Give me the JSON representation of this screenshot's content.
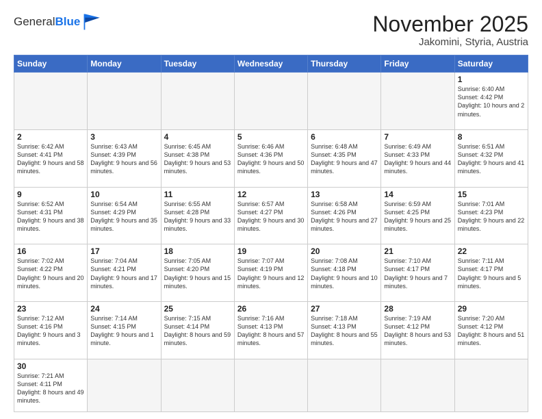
{
  "header": {
    "logo_general": "General",
    "logo_blue": "Blue",
    "month": "November 2025",
    "location": "Jakomini, Styria, Austria"
  },
  "weekdays": [
    "Sunday",
    "Monday",
    "Tuesday",
    "Wednesday",
    "Thursday",
    "Friday",
    "Saturday"
  ],
  "weeks": [
    [
      {
        "day": "",
        "info": ""
      },
      {
        "day": "",
        "info": ""
      },
      {
        "day": "",
        "info": ""
      },
      {
        "day": "",
        "info": ""
      },
      {
        "day": "",
        "info": ""
      },
      {
        "day": "",
        "info": ""
      },
      {
        "day": "1",
        "info": "Sunrise: 6:40 AM\nSunset: 4:42 PM\nDaylight: 10 hours\nand 2 minutes."
      }
    ],
    [
      {
        "day": "2",
        "info": "Sunrise: 6:42 AM\nSunset: 4:41 PM\nDaylight: 9 hours\nand 58 minutes."
      },
      {
        "day": "3",
        "info": "Sunrise: 6:43 AM\nSunset: 4:39 PM\nDaylight: 9 hours\nand 56 minutes."
      },
      {
        "day": "4",
        "info": "Sunrise: 6:45 AM\nSunset: 4:38 PM\nDaylight: 9 hours\nand 53 minutes."
      },
      {
        "day": "5",
        "info": "Sunrise: 6:46 AM\nSunset: 4:36 PM\nDaylight: 9 hours\nand 50 minutes."
      },
      {
        "day": "6",
        "info": "Sunrise: 6:48 AM\nSunset: 4:35 PM\nDaylight: 9 hours\nand 47 minutes."
      },
      {
        "day": "7",
        "info": "Sunrise: 6:49 AM\nSunset: 4:33 PM\nDaylight: 9 hours\nand 44 minutes."
      },
      {
        "day": "8",
        "info": "Sunrise: 6:51 AM\nSunset: 4:32 PM\nDaylight: 9 hours\nand 41 minutes."
      }
    ],
    [
      {
        "day": "9",
        "info": "Sunrise: 6:52 AM\nSunset: 4:31 PM\nDaylight: 9 hours\nand 38 minutes."
      },
      {
        "day": "10",
        "info": "Sunrise: 6:54 AM\nSunset: 4:29 PM\nDaylight: 9 hours\nand 35 minutes."
      },
      {
        "day": "11",
        "info": "Sunrise: 6:55 AM\nSunset: 4:28 PM\nDaylight: 9 hours\nand 33 minutes."
      },
      {
        "day": "12",
        "info": "Sunrise: 6:57 AM\nSunset: 4:27 PM\nDaylight: 9 hours\nand 30 minutes."
      },
      {
        "day": "13",
        "info": "Sunrise: 6:58 AM\nSunset: 4:26 PM\nDaylight: 9 hours\nand 27 minutes."
      },
      {
        "day": "14",
        "info": "Sunrise: 6:59 AM\nSunset: 4:25 PM\nDaylight: 9 hours\nand 25 minutes."
      },
      {
        "day": "15",
        "info": "Sunrise: 7:01 AM\nSunset: 4:23 PM\nDaylight: 9 hours\nand 22 minutes."
      }
    ],
    [
      {
        "day": "16",
        "info": "Sunrise: 7:02 AM\nSunset: 4:22 PM\nDaylight: 9 hours\nand 20 minutes."
      },
      {
        "day": "17",
        "info": "Sunrise: 7:04 AM\nSunset: 4:21 PM\nDaylight: 9 hours\nand 17 minutes."
      },
      {
        "day": "18",
        "info": "Sunrise: 7:05 AM\nSunset: 4:20 PM\nDaylight: 9 hours\nand 15 minutes."
      },
      {
        "day": "19",
        "info": "Sunrise: 7:07 AM\nSunset: 4:19 PM\nDaylight: 9 hours\nand 12 minutes."
      },
      {
        "day": "20",
        "info": "Sunrise: 7:08 AM\nSunset: 4:18 PM\nDaylight: 9 hours\nand 10 minutes."
      },
      {
        "day": "21",
        "info": "Sunrise: 7:10 AM\nSunset: 4:17 PM\nDaylight: 9 hours\nand 7 minutes."
      },
      {
        "day": "22",
        "info": "Sunrise: 7:11 AM\nSunset: 4:17 PM\nDaylight: 9 hours\nand 5 minutes."
      }
    ],
    [
      {
        "day": "23",
        "info": "Sunrise: 7:12 AM\nSunset: 4:16 PM\nDaylight: 9 hours\nand 3 minutes."
      },
      {
        "day": "24",
        "info": "Sunrise: 7:14 AM\nSunset: 4:15 PM\nDaylight: 9 hours\nand 1 minute."
      },
      {
        "day": "25",
        "info": "Sunrise: 7:15 AM\nSunset: 4:14 PM\nDaylight: 8 hours\nand 59 minutes."
      },
      {
        "day": "26",
        "info": "Sunrise: 7:16 AM\nSunset: 4:13 PM\nDaylight: 8 hours\nand 57 minutes."
      },
      {
        "day": "27",
        "info": "Sunrise: 7:18 AM\nSunset: 4:13 PM\nDaylight: 8 hours\nand 55 minutes."
      },
      {
        "day": "28",
        "info": "Sunrise: 7:19 AM\nSunset: 4:12 PM\nDaylight: 8 hours\nand 53 minutes."
      },
      {
        "day": "29",
        "info": "Sunrise: 7:20 AM\nSunset: 4:12 PM\nDaylight: 8 hours\nand 51 minutes."
      }
    ],
    [
      {
        "day": "30",
        "info": "Sunrise: 7:21 AM\nSunset: 4:11 PM\nDaylight: 8 hours\nand 49 minutes."
      },
      {
        "day": "",
        "info": ""
      },
      {
        "day": "",
        "info": ""
      },
      {
        "day": "",
        "info": ""
      },
      {
        "day": "",
        "info": ""
      },
      {
        "day": "",
        "info": ""
      },
      {
        "day": "",
        "info": ""
      }
    ]
  ]
}
